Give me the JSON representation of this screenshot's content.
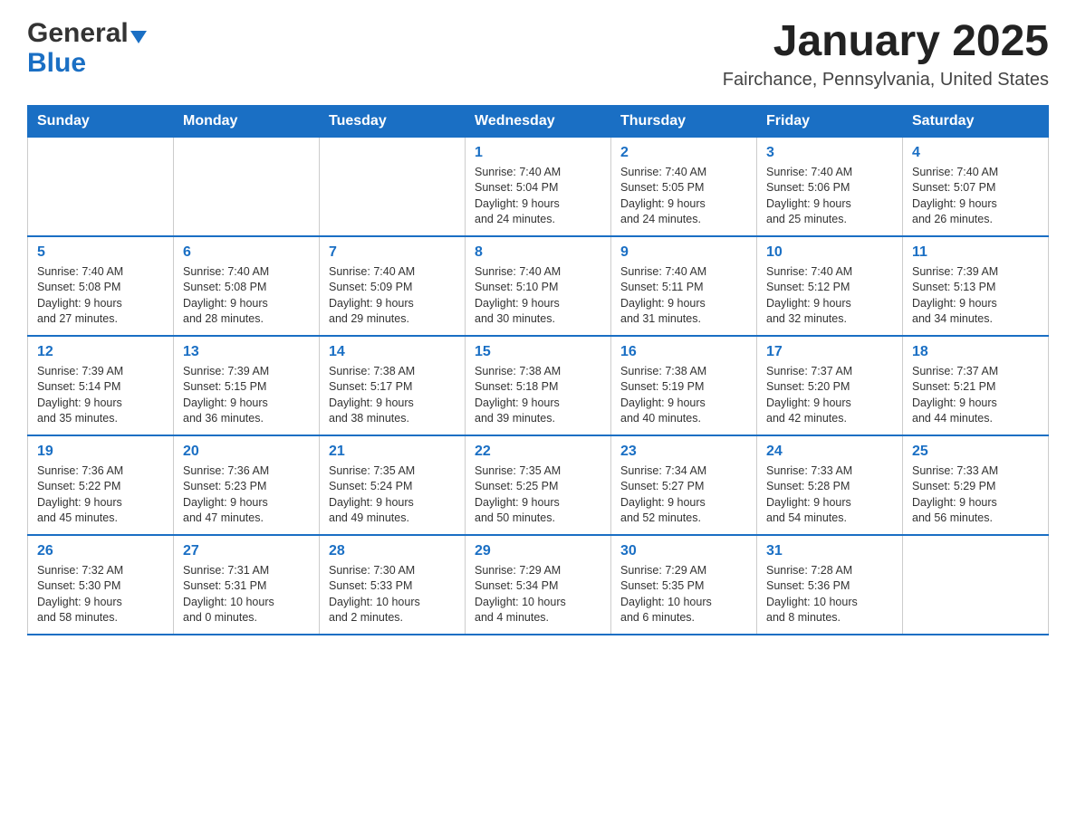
{
  "logo": {
    "general": "General",
    "blue": "Blue"
  },
  "title": "January 2025",
  "location": "Fairchance, Pennsylvania, United States",
  "weekdays": [
    "Sunday",
    "Monday",
    "Tuesday",
    "Wednesday",
    "Thursday",
    "Friday",
    "Saturday"
  ],
  "weeks": [
    [
      {
        "day": "",
        "info": ""
      },
      {
        "day": "",
        "info": ""
      },
      {
        "day": "",
        "info": ""
      },
      {
        "day": "1",
        "info": "Sunrise: 7:40 AM\nSunset: 5:04 PM\nDaylight: 9 hours\nand 24 minutes."
      },
      {
        "day": "2",
        "info": "Sunrise: 7:40 AM\nSunset: 5:05 PM\nDaylight: 9 hours\nand 24 minutes."
      },
      {
        "day": "3",
        "info": "Sunrise: 7:40 AM\nSunset: 5:06 PM\nDaylight: 9 hours\nand 25 minutes."
      },
      {
        "day": "4",
        "info": "Sunrise: 7:40 AM\nSunset: 5:07 PM\nDaylight: 9 hours\nand 26 minutes."
      }
    ],
    [
      {
        "day": "5",
        "info": "Sunrise: 7:40 AM\nSunset: 5:08 PM\nDaylight: 9 hours\nand 27 minutes."
      },
      {
        "day": "6",
        "info": "Sunrise: 7:40 AM\nSunset: 5:08 PM\nDaylight: 9 hours\nand 28 minutes."
      },
      {
        "day": "7",
        "info": "Sunrise: 7:40 AM\nSunset: 5:09 PM\nDaylight: 9 hours\nand 29 minutes."
      },
      {
        "day": "8",
        "info": "Sunrise: 7:40 AM\nSunset: 5:10 PM\nDaylight: 9 hours\nand 30 minutes."
      },
      {
        "day": "9",
        "info": "Sunrise: 7:40 AM\nSunset: 5:11 PM\nDaylight: 9 hours\nand 31 minutes."
      },
      {
        "day": "10",
        "info": "Sunrise: 7:40 AM\nSunset: 5:12 PM\nDaylight: 9 hours\nand 32 minutes."
      },
      {
        "day": "11",
        "info": "Sunrise: 7:39 AM\nSunset: 5:13 PM\nDaylight: 9 hours\nand 34 minutes."
      }
    ],
    [
      {
        "day": "12",
        "info": "Sunrise: 7:39 AM\nSunset: 5:14 PM\nDaylight: 9 hours\nand 35 minutes."
      },
      {
        "day": "13",
        "info": "Sunrise: 7:39 AM\nSunset: 5:15 PM\nDaylight: 9 hours\nand 36 minutes."
      },
      {
        "day": "14",
        "info": "Sunrise: 7:38 AM\nSunset: 5:17 PM\nDaylight: 9 hours\nand 38 minutes."
      },
      {
        "day": "15",
        "info": "Sunrise: 7:38 AM\nSunset: 5:18 PM\nDaylight: 9 hours\nand 39 minutes."
      },
      {
        "day": "16",
        "info": "Sunrise: 7:38 AM\nSunset: 5:19 PM\nDaylight: 9 hours\nand 40 minutes."
      },
      {
        "day": "17",
        "info": "Sunrise: 7:37 AM\nSunset: 5:20 PM\nDaylight: 9 hours\nand 42 minutes."
      },
      {
        "day": "18",
        "info": "Sunrise: 7:37 AM\nSunset: 5:21 PM\nDaylight: 9 hours\nand 44 minutes."
      }
    ],
    [
      {
        "day": "19",
        "info": "Sunrise: 7:36 AM\nSunset: 5:22 PM\nDaylight: 9 hours\nand 45 minutes."
      },
      {
        "day": "20",
        "info": "Sunrise: 7:36 AM\nSunset: 5:23 PM\nDaylight: 9 hours\nand 47 minutes."
      },
      {
        "day": "21",
        "info": "Sunrise: 7:35 AM\nSunset: 5:24 PM\nDaylight: 9 hours\nand 49 minutes."
      },
      {
        "day": "22",
        "info": "Sunrise: 7:35 AM\nSunset: 5:25 PM\nDaylight: 9 hours\nand 50 minutes."
      },
      {
        "day": "23",
        "info": "Sunrise: 7:34 AM\nSunset: 5:27 PM\nDaylight: 9 hours\nand 52 minutes."
      },
      {
        "day": "24",
        "info": "Sunrise: 7:33 AM\nSunset: 5:28 PM\nDaylight: 9 hours\nand 54 minutes."
      },
      {
        "day": "25",
        "info": "Sunrise: 7:33 AM\nSunset: 5:29 PM\nDaylight: 9 hours\nand 56 minutes."
      }
    ],
    [
      {
        "day": "26",
        "info": "Sunrise: 7:32 AM\nSunset: 5:30 PM\nDaylight: 9 hours\nand 58 minutes."
      },
      {
        "day": "27",
        "info": "Sunrise: 7:31 AM\nSunset: 5:31 PM\nDaylight: 10 hours\nand 0 minutes."
      },
      {
        "day": "28",
        "info": "Sunrise: 7:30 AM\nSunset: 5:33 PM\nDaylight: 10 hours\nand 2 minutes."
      },
      {
        "day": "29",
        "info": "Sunrise: 7:29 AM\nSunset: 5:34 PM\nDaylight: 10 hours\nand 4 minutes."
      },
      {
        "day": "30",
        "info": "Sunrise: 7:29 AM\nSunset: 5:35 PM\nDaylight: 10 hours\nand 6 minutes."
      },
      {
        "day": "31",
        "info": "Sunrise: 7:28 AM\nSunset: 5:36 PM\nDaylight: 10 hours\nand 8 minutes."
      },
      {
        "day": "",
        "info": ""
      }
    ]
  ]
}
